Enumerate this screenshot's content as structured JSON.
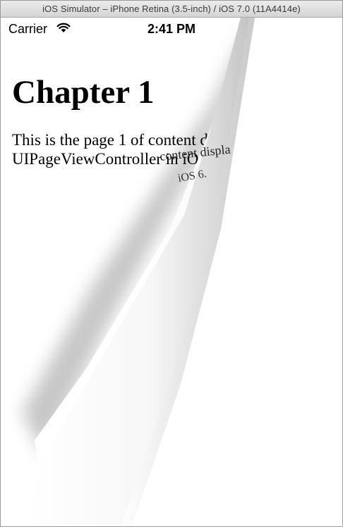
{
  "window": {
    "title": "iOS Simulator – iPhone Retina (3.5-inch) / iOS 7.0 (11A4414e)"
  },
  "status_bar": {
    "carrier": "Carrier",
    "time": "2:41 PM",
    "wifi_icon": "wifi-icon",
    "battery_icon": "battery-icon"
  },
  "page": {
    "chapter_title": "Chapter 1",
    "body": "This is the page 1 of content displayed using UIPageViewController in iOS 6.",
    "curled_text_line1": "content displa",
    "curled_text_line2": "iOS 6."
  },
  "colors": {
    "background": "#ffffff",
    "text": "#000000",
    "titlebar": "#dcdcdc"
  }
}
